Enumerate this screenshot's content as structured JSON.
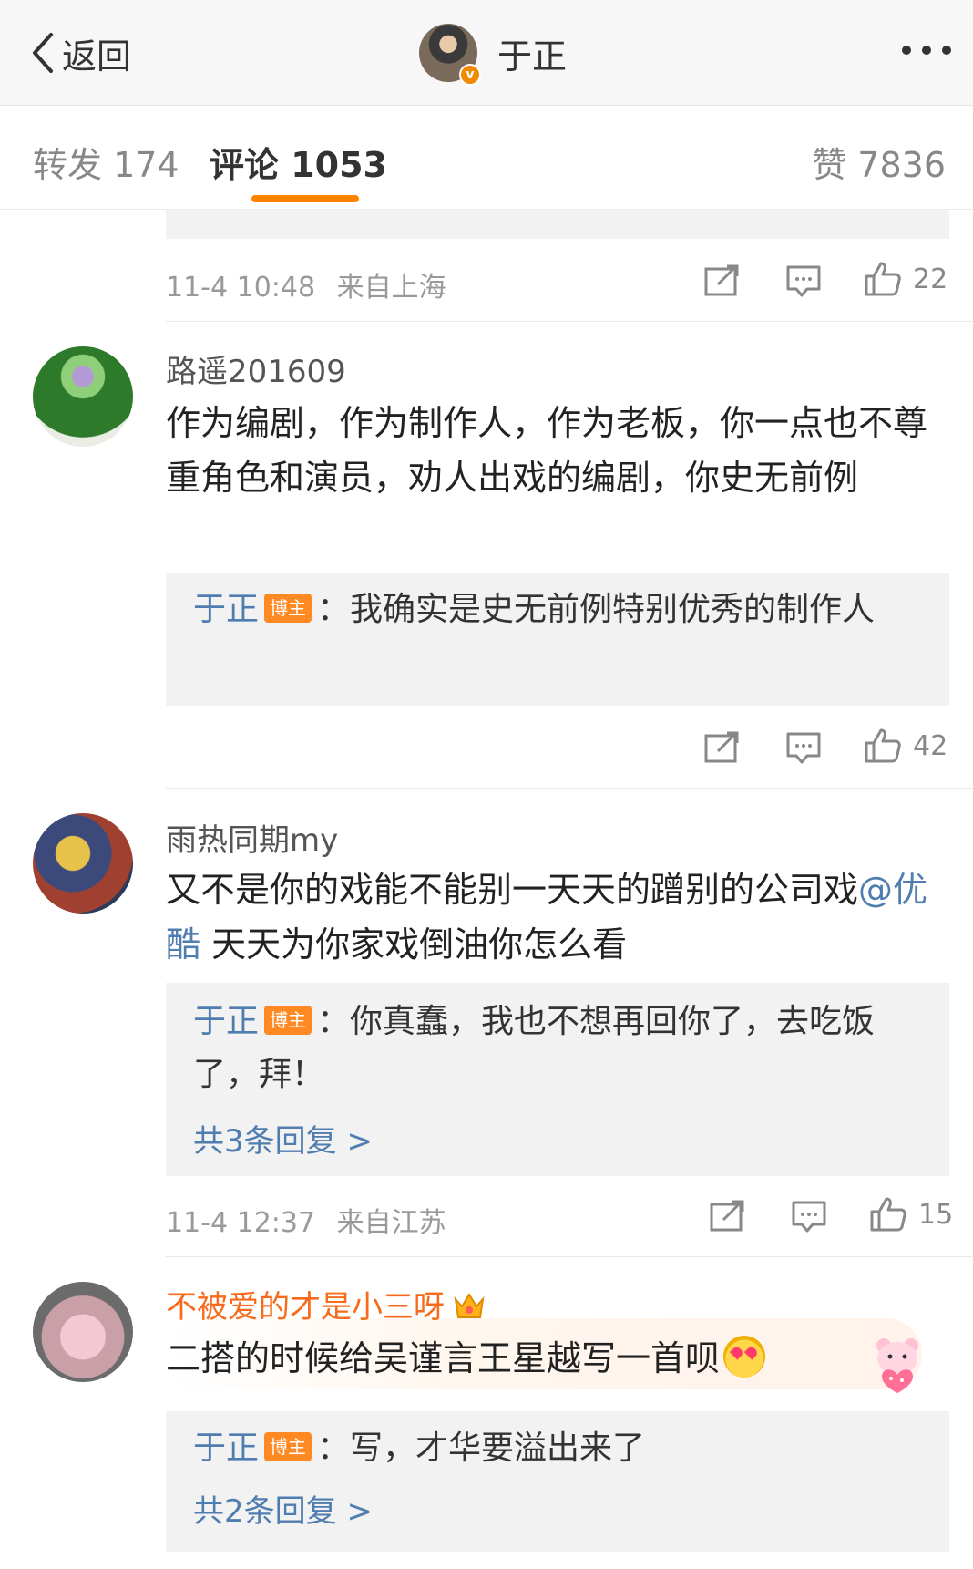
{
  "header": {
    "back_label": "返回",
    "title": "于正"
  },
  "tabs": {
    "repost": "转发 174",
    "comments": "评论 1053",
    "likes": "赞 7836"
  },
  "comments": [
    {
      "partial": true,
      "time": "11-4 10:48",
      "source": "来自上海",
      "likes": "22"
    },
    {
      "username": "路遥201609",
      "text": "作为编剧，作为制作人，作为老板，你一点也不尊重角色和演员，劝人出戏的编剧，你史无前例",
      "reply": {
        "author": "于正",
        "badge": "博主",
        "text": "：我确实是史无前例特别优秀的制作人"
      },
      "likes": "42"
    },
    {
      "username": "雨热同期my",
      "text_before": "又不是你的戏能不能别一天天的蹭别的公司戏",
      "mention": "@优酷",
      "text_after": " 天天为你家戏倒油你怎么看",
      "reply": {
        "author": "于正",
        "badge": "博主",
        "text": "：你真蠢，我也不想再回你了，去吃饭了，拜！"
      },
      "more_replies": "共3条回复 >",
      "time": "11-4 12:37",
      "source": "来自江苏",
      "likes": "15"
    },
    {
      "username": "不被爱的才是小三呀",
      "text": "二搭的时候给吴谨言王星越写一首呗",
      "reply": {
        "author": "于正",
        "badge": "博主",
        "text": "：写，才华要溢出来了"
      },
      "more_replies": "共2条回复 >"
    }
  ],
  "colors": {
    "accent": "#ff8200",
    "link": "#507daf",
    "vip_name": "#f86b1c",
    "quote_bg": "#f2f2f2"
  },
  "icons": [
    "chevron-left-icon",
    "more-icon",
    "repost-icon",
    "comment-icon",
    "like-icon",
    "crown-icon",
    "heart-eyes-emoji",
    "bear-sticker"
  ]
}
